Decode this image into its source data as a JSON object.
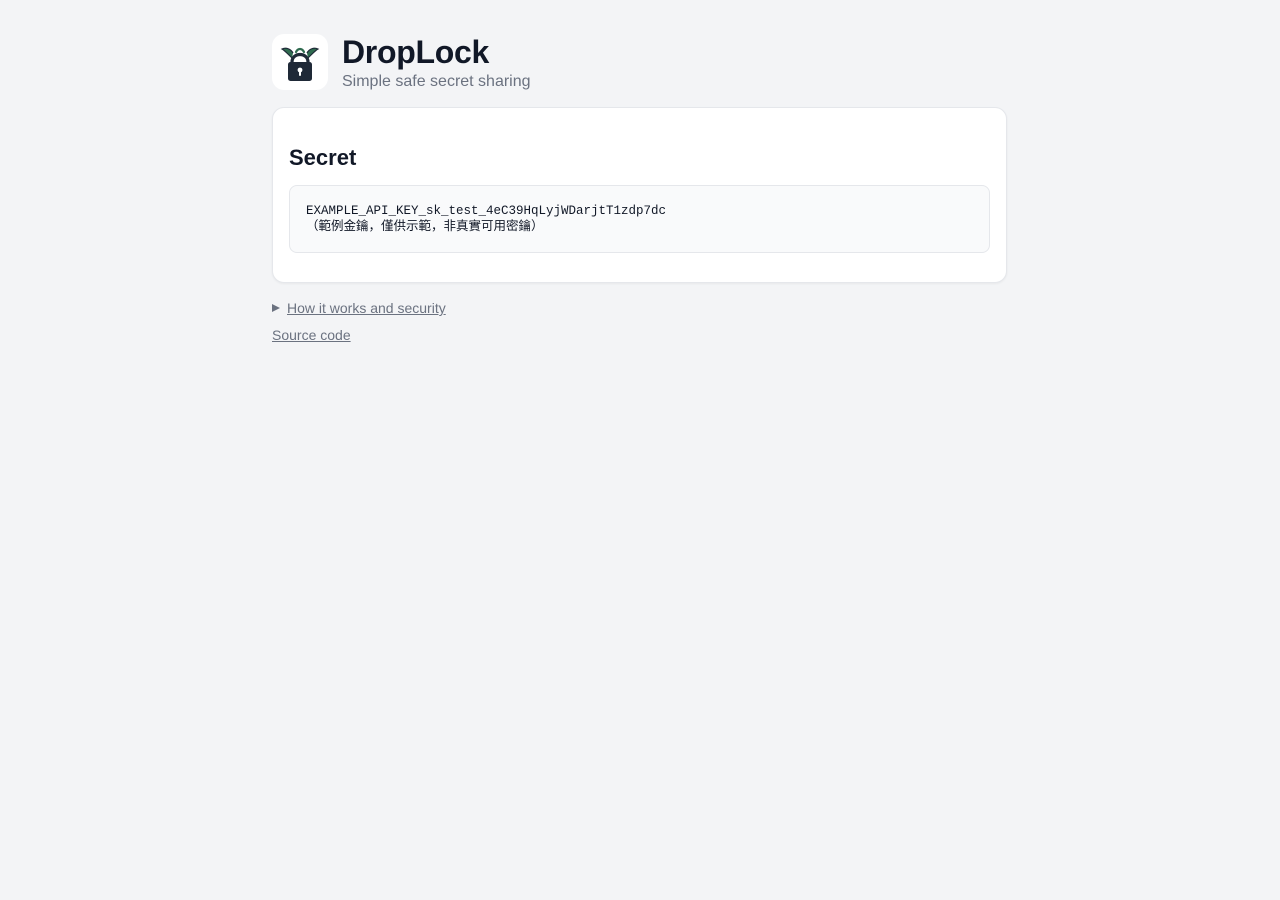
{
  "app": {
    "title": "DropLock",
    "subtitle": "Simple safe secret sharing",
    "logo_icon": "padlock-icon"
  },
  "card": {
    "title": "Secret",
    "secret_line1": "EXAMPLE_API_KEY_sk_test_4eC39HqLyjWDarjtT1zdp7dc",
    "secret_line2": "（範例金鑰，僅供示範，非真實可用密鑰）"
  },
  "footer": {
    "details_summary": "How it works and security",
    "source_link": "Source code"
  },
  "colors": {
    "background": "#f3f4f6",
    "card": "#ffffff",
    "text": "#111827",
    "muted": "#6b7280",
    "logo_dark": "#1f2937",
    "logo_green": "#2f6b4f"
  }
}
